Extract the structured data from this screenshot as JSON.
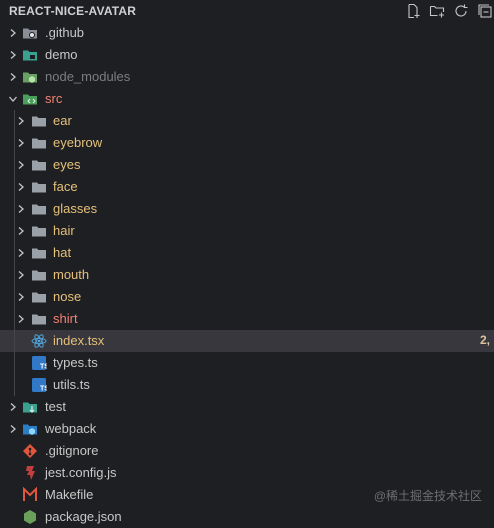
{
  "explorer": {
    "title": "REACT-NICE-AVATAR",
    "actions": [
      {
        "name": "new-file-icon"
      },
      {
        "name": "new-folder-icon"
      },
      {
        "name": "refresh-icon"
      },
      {
        "name": "collapse-all-icon"
      }
    ]
  },
  "tree": [
    {
      "label": ".github",
      "type": "folder",
      "icon": "github-folder-icon",
      "level": 0,
      "expanded": false,
      "color": "#c8c8c8"
    },
    {
      "label": "demo",
      "type": "folder",
      "icon": "demo-folder-icon",
      "level": 0,
      "expanded": false,
      "color": "#c8c8c8"
    },
    {
      "label": "node_modules",
      "type": "folder",
      "icon": "node-modules-folder-icon",
      "level": 0,
      "expanded": false,
      "color": "#7b7d80"
    },
    {
      "label": "src",
      "type": "folder",
      "icon": "src-folder-icon",
      "level": 0,
      "expanded": true,
      "color": "#f08373"
    },
    {
      "label": "ear",
      "type": "folder",
      "icon": "folder-icon",
      "level": 1,
      "expanded": false,
      "color": "#e5c07b"
    },
    {
      "label": "eyebrow",
      "type": "folder",
      "icon": "folder-icon",
      "level": 1,
      "expanded": false,
      "color": "#e5c07b"
    },
    {
      "label": "eyes",
      "type": "folder",
      "icon": "folder-icon",
      "level": 1,
      "expanded": false,
      "color": "#e5c07b"
    },
    {
      "label": "face",
      "type": "folder",
      "icon": "folder-icon",
      "level": 1,
      "expanded": false,
      "color": "#e5c07b"
    },
    {
      "label": "glasses",
      "type": "folder",
      "icon": "folder-icon",
      "level": 1,
      "expanded": false,
      "color": "#e5c07b"
    },
    {
      "label": "hair",
      "type": "folder",
      "icon": "folder-icon",
      "level": 1,
      "expanded": false,
      "color": "#e5c07b"
    },
    {
      "label": "hat",
      "type": "folder",
      "icon": "folder-icon",
      "level": 1,
      "expanded": false,
      "color": "#e5c07b"
    },
    {
      "label": "mouth",
      "type": "folder",
      "icon": "folder-icon",
      "level": 1,
      "expanded": false,
      "color": "#e5c07b"
    },
    {
      "label": "nose",
      "type": "folder",
      "icon": "folder-icon",
      "level": 1,
      "expanded": false,
      "color": "#e5c07b"
    },
    {
      "label": "shirt",
      "type": "folder",
      "icon": "folder-icon",
      "level": 1,
      "expanded": false,
      "color": "#f08373"
    },
    {
      "label": "index.tsx",
      "type": "file",
      "icon": "react-ts-icon",
      "level": 1,
      "color": "#e5c07b",
      "selected": true,
      "badge": "2,"
    },
    {
      "label": "types.ts",
      "type": "file",
      "icon": "typescript-icon",
      "level": 1,
      "color": "#c8c8c8"
    },
    {
      "label": "utils.ts",
      "type": "file",
      "icon": "typescript-icon",
      "level": 1,
      "color": "#c8c8c8"
    },
    {
      "label": "test",
      "type": "folder",
      "icon": "test-folder-icon",
      "level": 0,
      "expanded": false,
      "color": "#c8c8c8"
    },
    {
      "label": "webpack",
      "type": "folder",
      "icon": "webpack-folder-icon",
      "level": 0,
      "expanded": false,
      "color": "#c8c8c8"
    },
    {
      "label": ".gitignore",
      "type": "file",
      "icon": "git-icon",
      "level": 0,
      "color": "#c8c8c8"
    },
    {
      "label": "jest.config.js",
      "type": "file",
      "icon": "jest-icon",
      "level": 0,
      "color": "#c8c8c8"
    },
    {
      "label": "Makefile",
      "type": "file",
      "icon": "makefile-icon",
      "level": 0,
      "color": "#c8c8c8"
    },
    {
      "label": "package.json",
      "type": "file",
      "icon": "nodejs-icon",
      "level": 0,
      "color": "#c8c8c8"
    }
  ],
  "watermark": "@稀土掘金技术社区",
  "colors": {
    "background": "#1e1f22",
    "selected_row": "#37373d",
    "folder": "#9aa0a8",
    "typescript": "#3178c6"
  }
}
